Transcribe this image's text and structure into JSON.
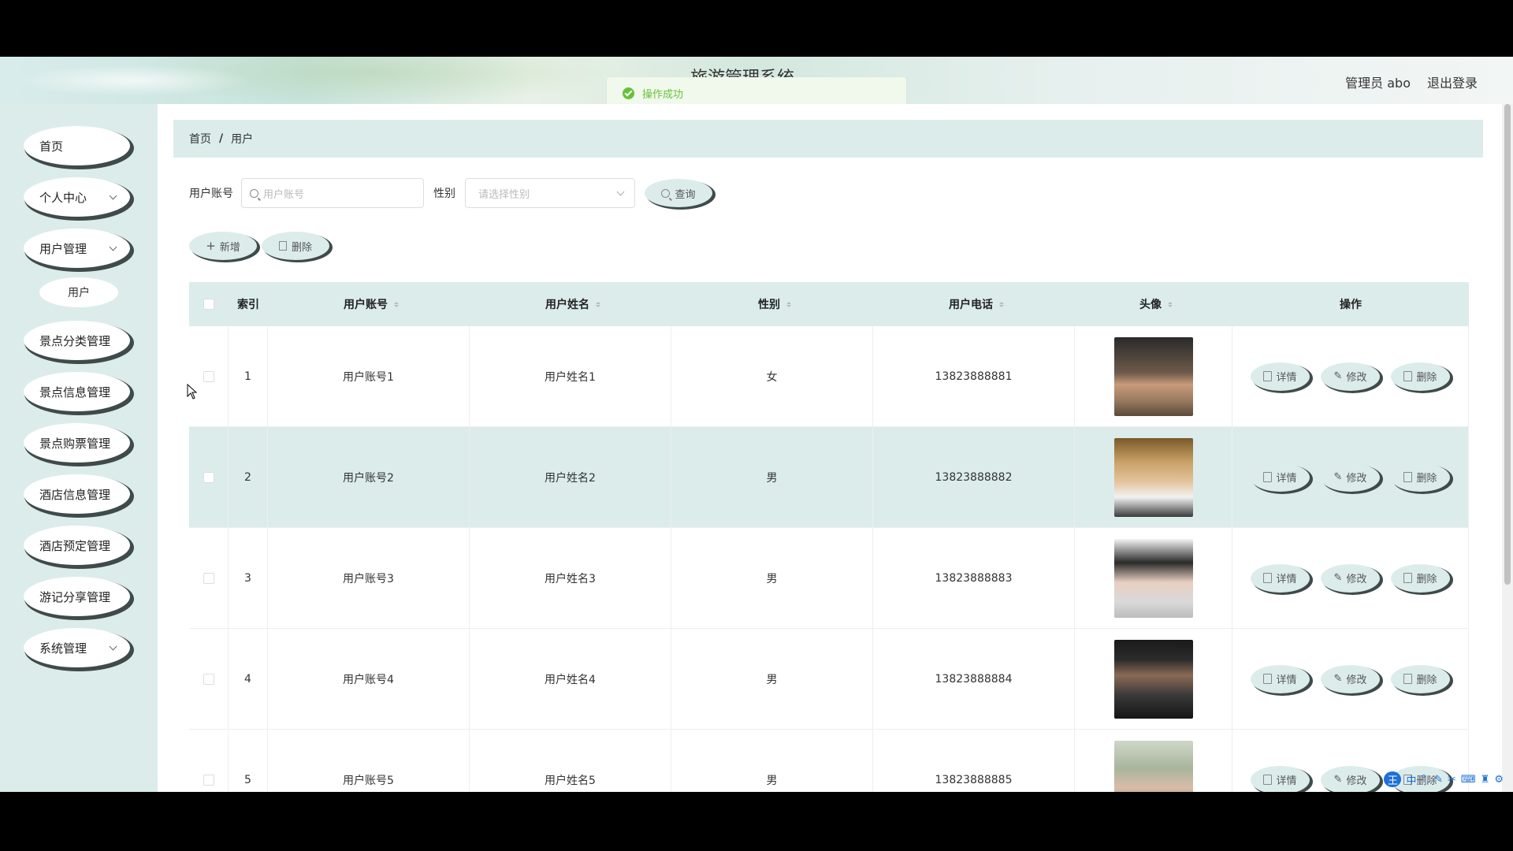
{
  "header": {
    "app_title": "旅游管理系统",
    "admin_label": "管理员 abo",
    "logout_label": "退出登录",
    "toast": "操作成功"
  },
  "sidebar": {
    "items": [
      {
        "label": "首页",
        "has_chevron": false
      },
      {
        "label": "个人中心",
        "has_chevron": true
      },
      {
        "label": "用户管理",
        "has_chevron": true
      },
      {
        "label": "景点分类管理",
        "has_chevron": false
      },
      {
        "label": "景点信息管理",
        "has_chevron": false
      },
      {
        "label": "景点购票管理",
        "has_chevron": false
      },
      {
        "label": "酒店信息管理",
        "has_chevron": false
      },
      {
        "label": "酒店预定管理",
        "has_chevron": false
      },
      {
        "label": "游记分享管理",
        "has_chevron": false
      },
      {
        "label": "系统管理",
        "has_chevron": true
      }
    ],
    "submenu": "用户"
  },
  "breadcrumb": {
    "home": "首页",
    "current": "用户"
  },
  "search": {
    "account_label": "用户账号",
    "account_placeholder": "用户账号",
    "gender_label": "性别",
    "gender_placeholder": "请选择性别",
    "query_button": "查询"
  },
  "actions": {
    "add": "新增",
    "delete": "删除"
  },
  "table": {
    "columns": [
      "索引",
      "用户账号",
      "用户姓名",
      "性别",
      "用户电话",
      "头像",
      "操作"
    ],
    "rows": [
      {
        "index": "1",
        "account": "用户账号1",
        "name": "用户姓名1",
        "gender": "女",
        "phone": "13823888881"
      },
      {
        "index": "2",
        "account": "用户账号2",
        "name": "用户姓名2",
        "gender": "男",
        "phone": "13823888882"
      },
      {
        "index": "3",
        "account": "用户账号3",
        "name": "用户姓名3",
        "gender": "男",
        "phone": "13823888883"
      },
      {
        "index": "4",
        "account": "用户账号4",
        "name": "用户姓名4",
        "gender": "男",
        "phone": "13823888884"
      },
      {
        "index": "5",
        "account": "用户账号5",
        "name": "用户姓名5",
        "gender": "男",
        "phone": "13823888885"
      }
    ],
    "row_actions": {
      "detail": "详情",
      "edit": "修改",
      "delete": "删除"
    }
  },
  "ime": {
    "logo": "王",
    "mode": "中"
  }
}
